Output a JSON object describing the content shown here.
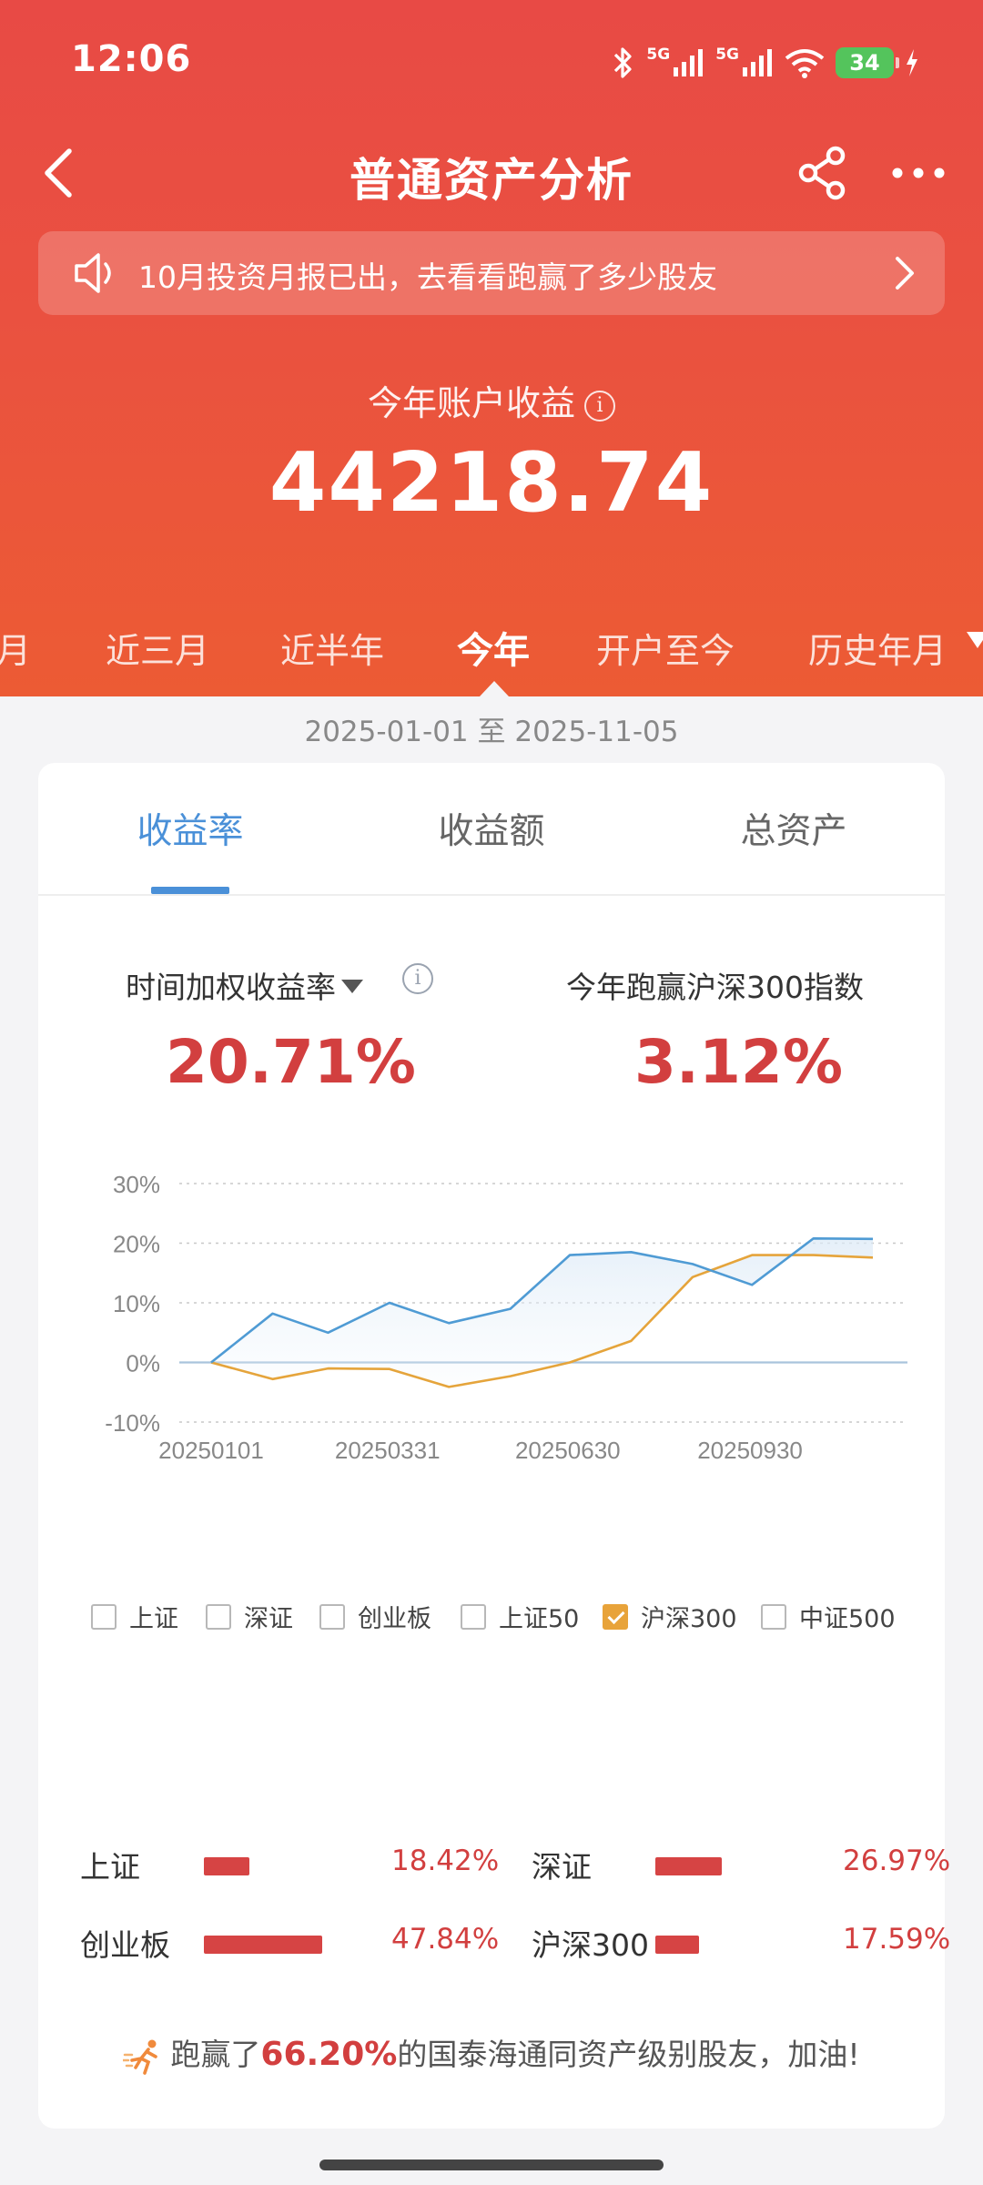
{
  "status_bar": {
    "time": "12:06",
    "battery": "34",
    "signal_label": "5G"
  },
  "nav": {
    "title": "普通资产分析"
  },
  "notice": {
    "text": "10月投资月报已出，去看看跑赢了多少股友"
  },
  "summary": {
    "label": "今年账户收益",
    "value": "44218.74"
  },
  "period_tabs": [
    {
      "label": "月"
    },
    {
      "label": "近三月"
    },
    {
      "label": "近半年"
    },
    {
      "label": "今年",
      "active": true
    },
    {
      "label": "开户至今"
    },
    {
      "label": "历史年月"
    }
  ],
  "date_range": "2025-01-01 至 2025-11-05",
  "metric_tabs": [
    {
      "label": "收益率",
      "active": true
    },
    {
      "label": "收益额"
    },
    {
      "label": "总资产"
    }
  ],
  "stats": {
    "twr_label": "时间加权收益率",
    "twr_value": "20.71%",
    "beat_label": "今年跑赢沪深300指数",
    "beat_value": "3.12%"
  },
  "chart_data": {
    "type": "line",
    "ylim": [
      -10,
      30
    ],
    "yticks": [
      "30%",
      "20%",
      "10%",
      "0%",
      "-10%"
    ],
    "xticks": [
      "20250101",
      "20250331",
      "20250630",
      "20250930"
    ],
    "grid": true,
    "series": [
      {
        "color": "#4f9bd4",
        "x": [
          "2025-01-01",
          "2025-02-01",
          "2025-03-01",
          "2025-04-01",
          "2025-05-01",
          "2025-06-01",
          "2025-07-01",
          "2025-08-01",
          "2025-09-01",
          "2025-10-01",
          "2025-11-01",
          "2025-12-01"
        ],
        "y": [
          0,
          8.2,
          5.0,
          10.0,
          6.6,
          9.0,
          18.0,
          18.5,
          16.5,
          13.0,
          20.8,
          20.71
        ]
      },
      {
        "name": "沪深300",
        "color": "#e5a43b",
        "x": [
          "2025-01-01",
          "2025-02-01",
          "2025-03-01",
          "2025-04-01",
          "2025-05-01",
          "2025-06-01",
          "2025-07-01",
          "2025-08-01",
          "2025-09-01",
          "2025-10-01",
          "2025-11-01",
          "2025-12-01"
        ],
        "y": [
          0,
          -2.8,
          -1.0,
          -1.1,
          -4.1,
          -2.3,
          0,
          3.6,
          14.3,
          18.0,
          18.0,
          17.59
        ]
      }
    ]
  },
  "legend": [
    {
      "label": "上证",
      "checked": false
    },
    {
      "label": "深证",
      "checked": false
    },
    {
      "label": "创业板",
      "checked": false
    },
    {
      "label": "上证50",
      "checked": false
    },
    {
      "label": "沪深300",
      "checked": true
    },
    {
      "label": "中证500",
      "checked": false
    }
  ],
  "index_returns": [
    {
      "name": "上证",
      "value": "18.42%",
      "ratio": 0.385
    },
    {
      "name": "深证",
      "value": "26.97%",
      "ratio": 0.5638
    },
    {
      "name": "创业板",
      "value": "47.84%",
      "ratio": 1.0
    },
    {
      "name": "沪深300",
      "value": "17.59%",
      "ratio": 0.3677
    }
  ],
  "beat_banner": {
    "prefix": "跑赢了",
    "highlight": "66.20%",
    "suffix": "的国泰海通同资产级别股友，加油!"
  },
  "colors": {
    "brand_red": "#e84a45",
    "accent_blue": "#4a90d8",
    "value_red": "#d23f3f",
    "hs300_orange": "#e5a43b"
  }
}
